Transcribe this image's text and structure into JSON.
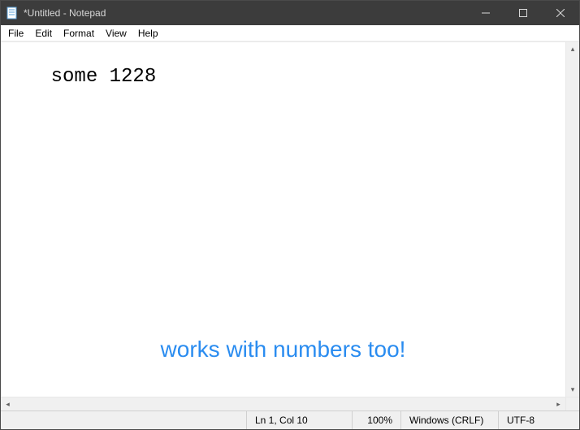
{
  "window": {
    "title": "*Untitled - Notepad"
  },
  "menu": {
    "items": [
      "File",
      "Edit",
      "Format",
      "View",
      "Help"
    ]
  },
  "editor": {
    "content": "some 1228"
  },
  "annotation": {
    "text": "works with numbers too!"
  },
  "status": {
    "position": "Ln 1, Col 10",
    "zoom": "100%",
    "line_ending": "Windows (CRLF)",
    "encoding": "UTF-8"
  }
}
